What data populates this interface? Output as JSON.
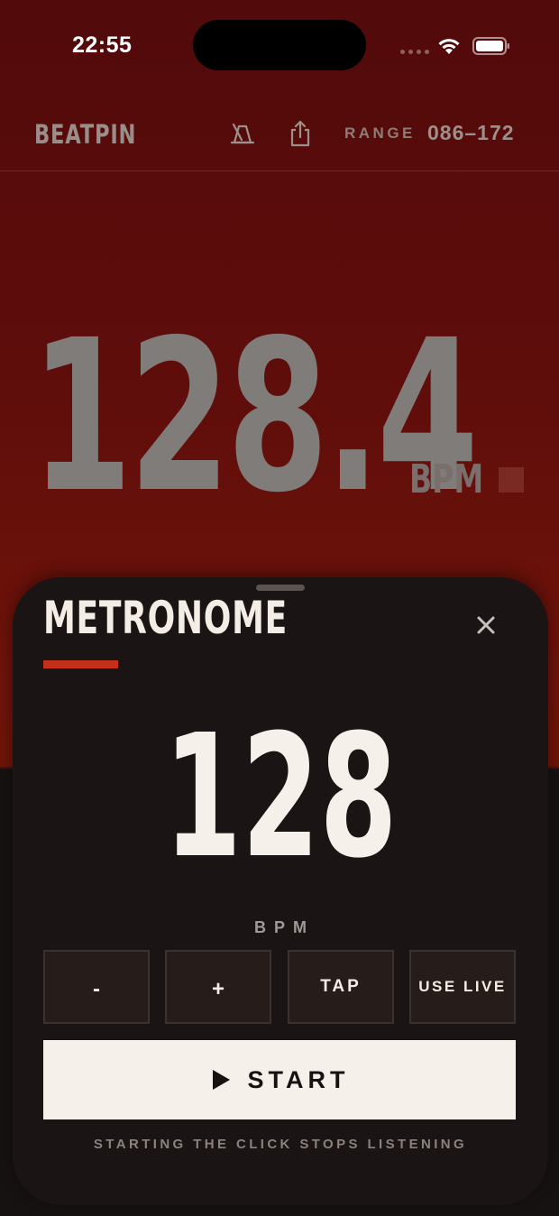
{
  "status_bar": {
    "time": "22:55",
    "icons": [
      "cellular-dots-icon",
      "wifi-icon",
      "battery-icon"
    ]
  },
  "header": {
    "brand": "BEATPIN",
    "icons": [
      "metronome-icon",
      "share-icon"
    ],
    "range_label": "RANGE",
    "range_value": "086–172"
  },
  "reading": {
    "bpm": "128.4",
    "unit": "BPM"
  },
  "metronome_sheet": {
    "title": "METRONOME",
    "close_icon": "close-icon",
    "value": "128",
    "unit": "BPM",
    "buttons": {
      "decrement": "-",
      "increment": "+",
      "tap": "TAP",
      "use_live": "USE LIVE"
    },
    "start_label": "START",
    "start_icon": "play-icon",
    "footnote": "STARTING THE CLICK STOPS LISTENING"
  },
  "colors": {
    "accent": "#c4311b",
    "sheet_bg": "#1a1414",
    "header_bg": "#520a0b",
    "primary_button": "#f5f1ea"
  }
}
